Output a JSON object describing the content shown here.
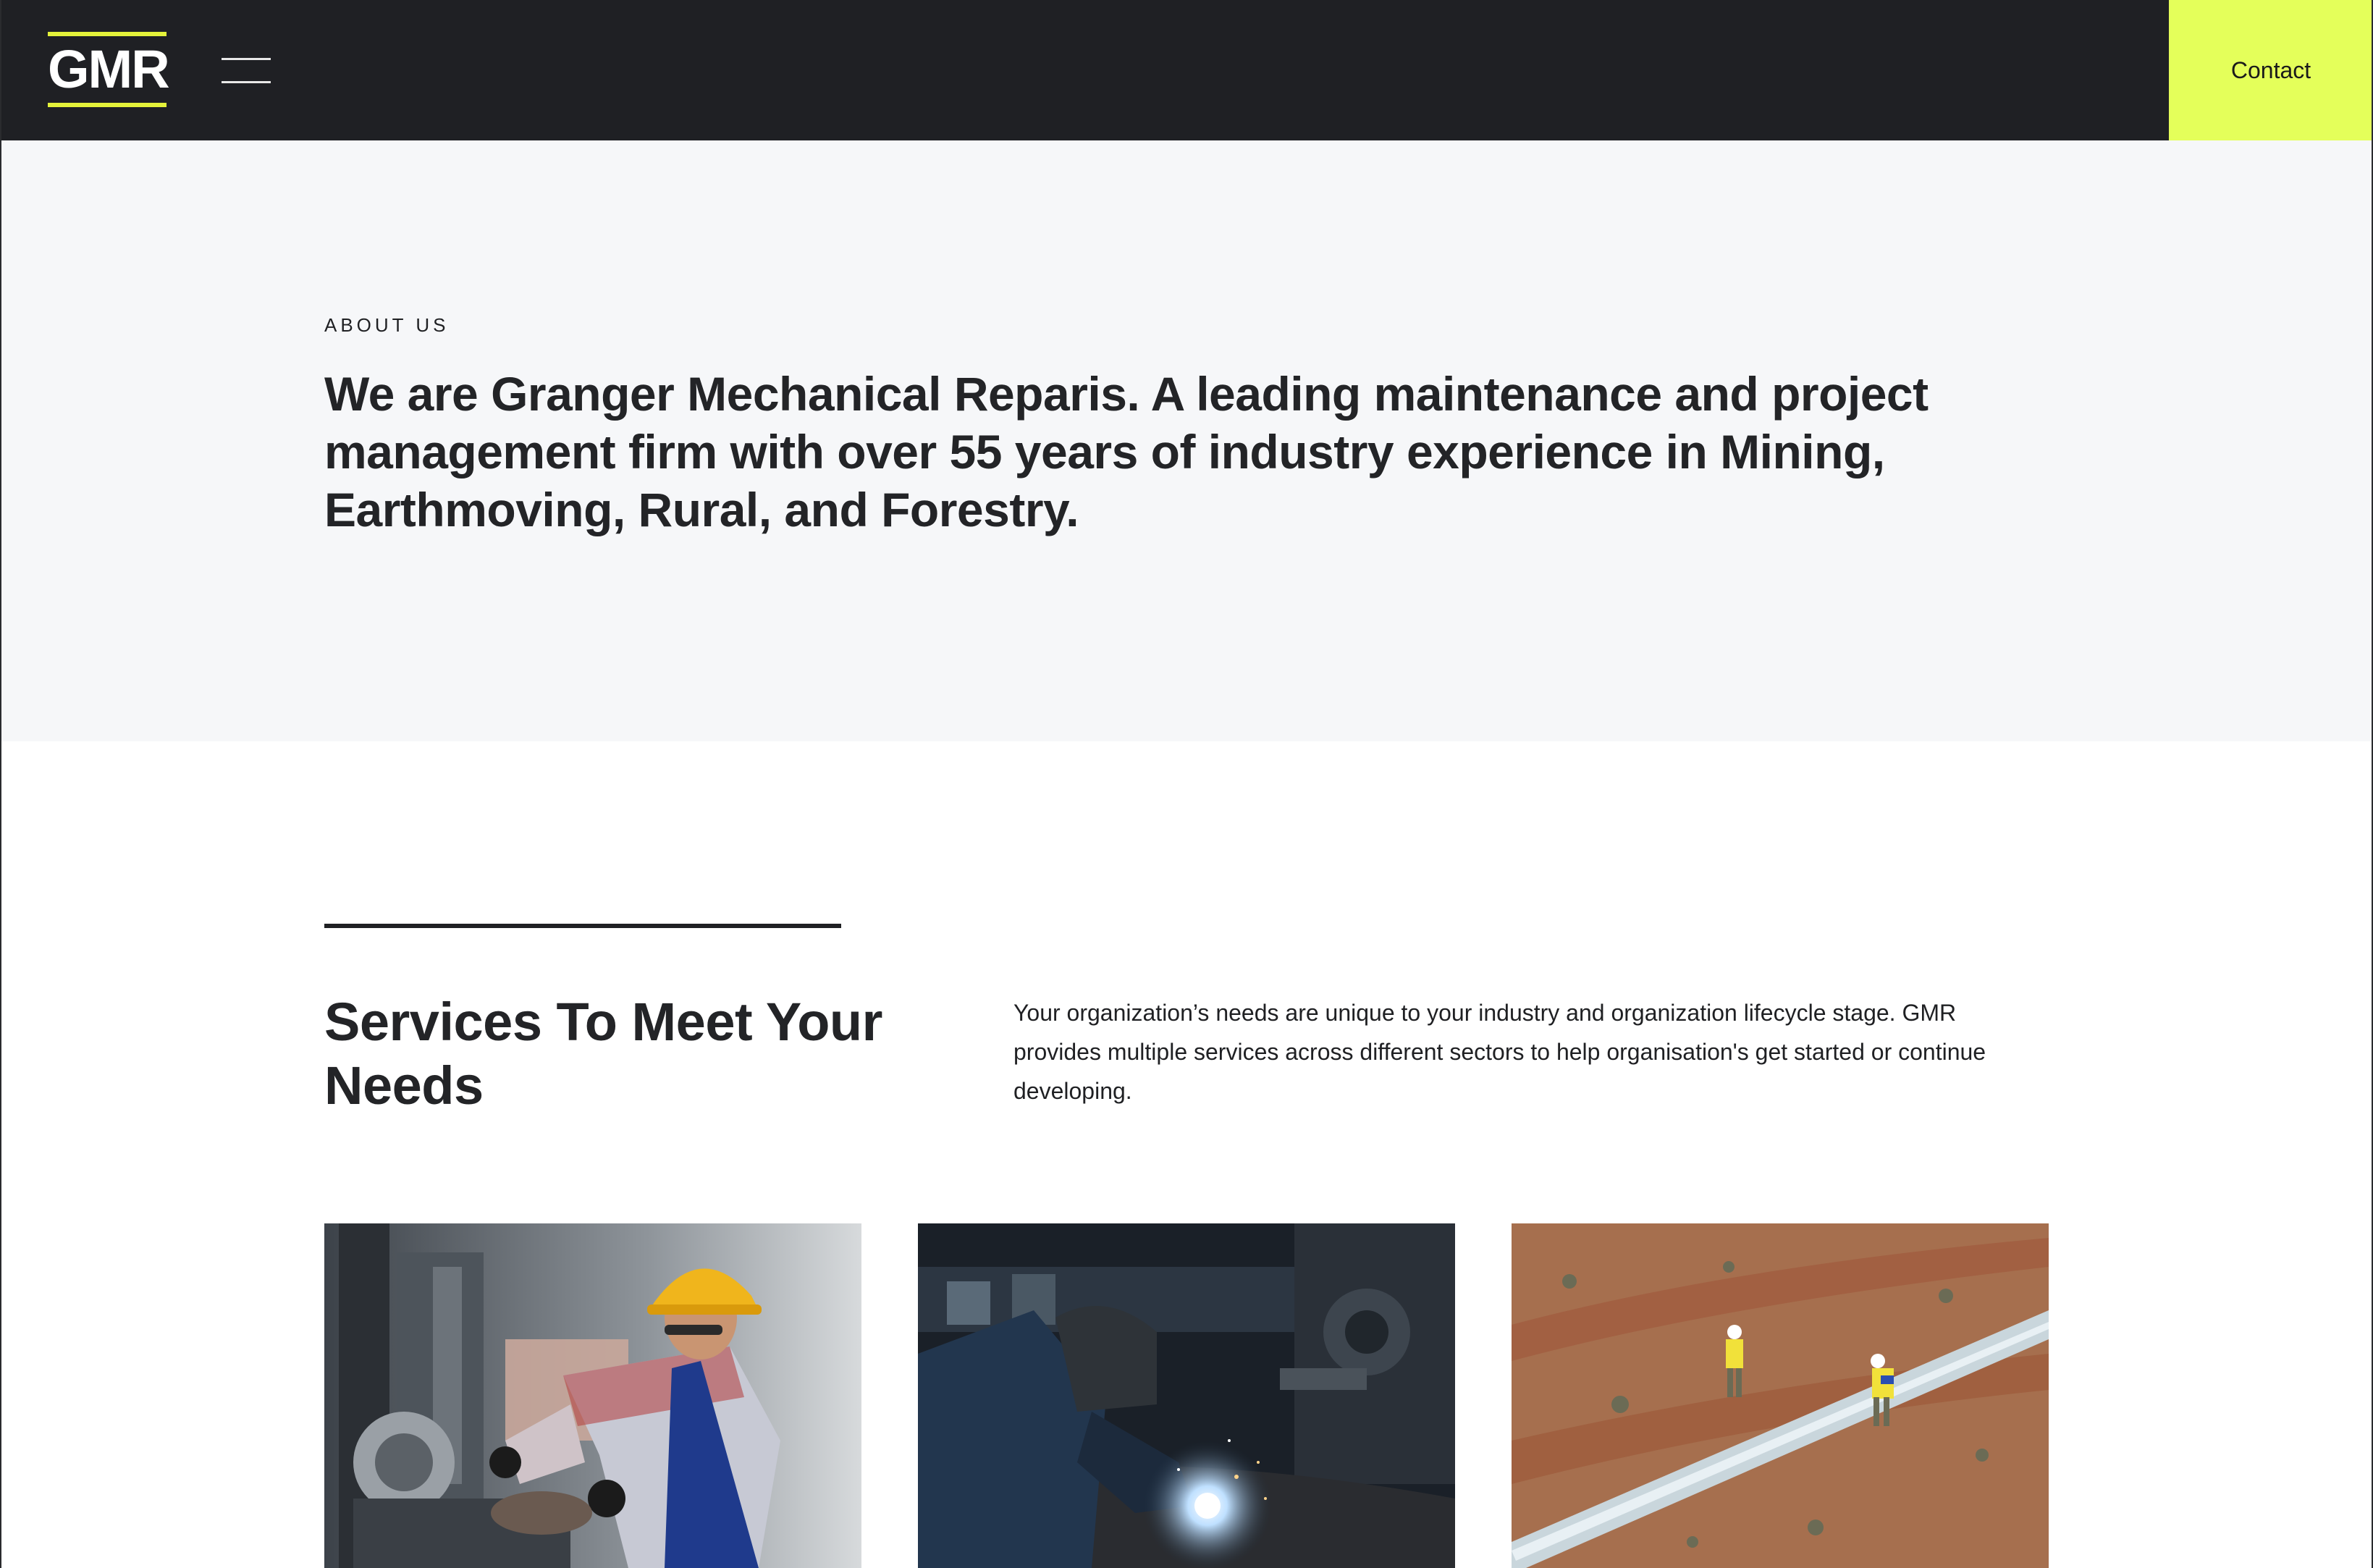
{
  "header": {
    "logo": "GMR",
    "contact_label": "Contact"
  },
  "about": {
    "eyebrow": "ABOUT US",
    "text": "We are Granger Mechanical Reparis. A leading maintenance and project management firm with over 55 years of industry experience in Mining, Earthmoving, Rural, and Forestry."
  },
  "services": {
    "title": "Services To Meet Your Needs",
    "description": "Your organization’s needs are unique to your industry and organization lifecycle stage. GMR provides multiple services across different sectors to help organisation's get started or continue developing."
  },
  "colors": {
    "header_bg": "#1f2024",
    "accent": "#e4ff5a",
    "logo_underline": "#e4f23a",
    "about_bg": "#f6f7f9"
  }
}
